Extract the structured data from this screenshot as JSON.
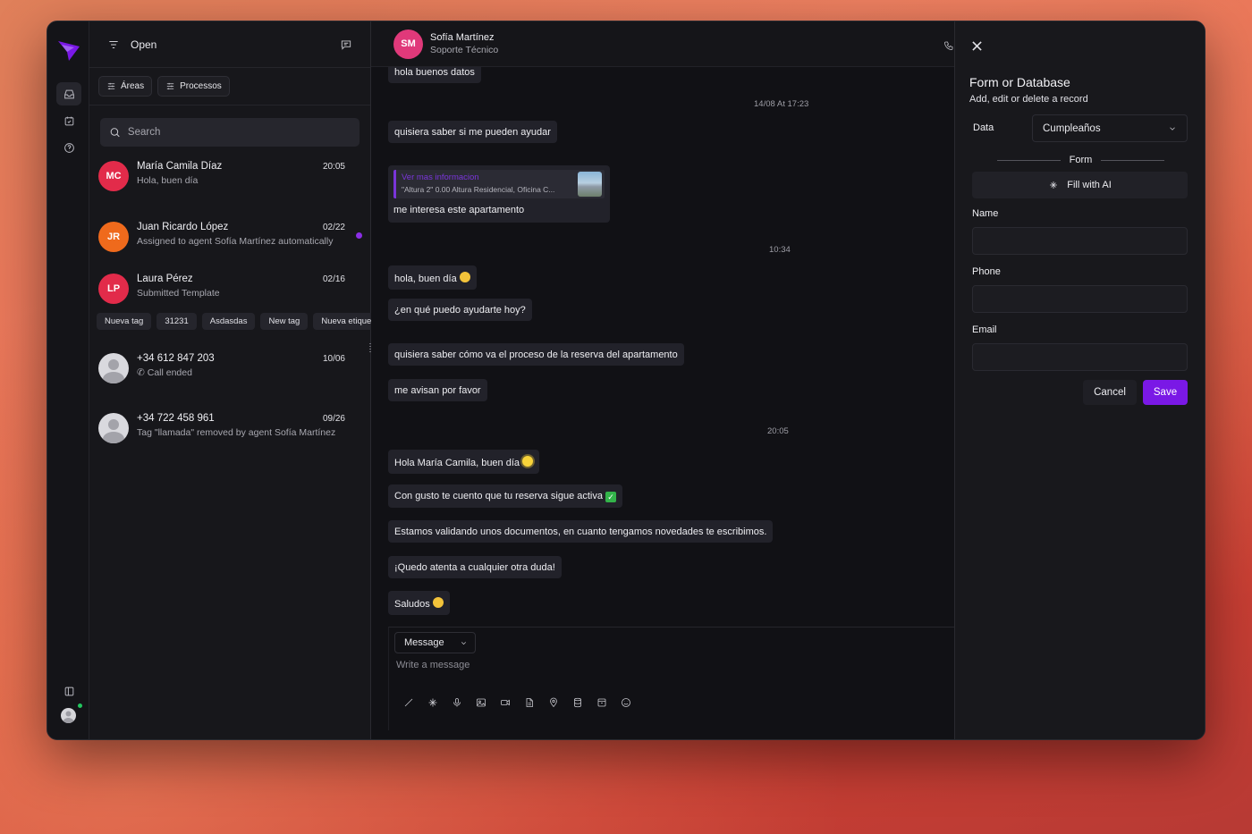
{
  "list": {
    "header": {
      "open_label": "Open"
    },
    "filters": [
      {
        "label": "Áreas"
      },
      {
        "label": "Processos"
      }
    ],
    "search": {
      "placeholder": "Search"
    },
    "conversations": [
      {
        "initials": "MC",
        "color": "#e22b4a",
        "name": "María Camila Díaz",
        "time": "20:05",
        "preview": "Hola, buen día"
      },
      {
        "initials": "JR",
        "color": "#ef6a1c",
        "name": "Juan Ricardo López",
        "time": "02/22",
        "preview": "Assigned to agent Sofía Martínez automatically"
      },
      {
        "initials": "LP",
        "color": "#e22b4a",
        "name": "Laura Pérez",
        "time": "02/16",
        "preview": "Submitted Template",
        "tags": [
          "Nueva tag",
          "31231",
          "Asdasdas",
          "New tag",
          "Nueva etiquette"
        ]
      },
      {
        "name": "+34 612 847 203",
        "time": "10/06",
        "preview": "Call ended"
      },
      {
        "name": "+34 722 458 961",
        "time": "09/26",
        "preview": "Tag \"llamada\" removed by agent Sofía Martínez"
      }
    ]
  },
  "chat": {
    "contact": {
      "initials": "SM",
      "name": "Sofía Martínez",
      "role": "Soporte Técnico"
    },
    "clipped_top": "hola buenos datos",
    "messages": {
      "sep1": "14/08 At 17:23",
      "m1": "quisiera saber si me pueden ayudar",
      "card_link": "Ver mas informacion",
      "card_desc": "\"Altura 2\" 0.00 Altura Residencial, Oficina C...",
      "card_caption": "me interesa este apartamento",
      "sep2": "10:34",
      "m2": "hola, buen día",
      "m3": "¿en qué puedo ayudarte hoy?",
      "m4": "quisiera saber cómo va el proceso de la reserva del apartamento",
      "m5": "me avisan por favor",
      "sep3": "20:05",
      "m6": "Hola María Camila, buen día",
      "m7": "Con gusto te cuento que tu reserva sigue activa",
      "m8": "Estamos validando unos documentos, en cuanto tengamos novedades te escribimos.",
      "m9": "¡Quedo atenta a cualquier otra duda!",
      "m10": "Saludos"
    },
    "composer": {
      "type_label": "Message",
      "placeholder": "Write a message"
    }
  },
  "panel": {
    "title": "Form or Database",
    "subtitle": "Add, edit or delete a record",
    "data_label": "Data",
    "data_value": "Cumpleaños",
    "form_divider": "Form",
    "fill_ai_label": "Fill with AI",
    "fields": {
      "name": "Name",
      "phone": "Phone",
      "email": "Email"
    },
    "cancel_label": "Cancel",
    "save_label": "Save"
  },
  "colors": {
    "accent": "#7a18e6",
    "sm_avatar": "#e0397a",
    "online": "#22c55e"
  }
}
